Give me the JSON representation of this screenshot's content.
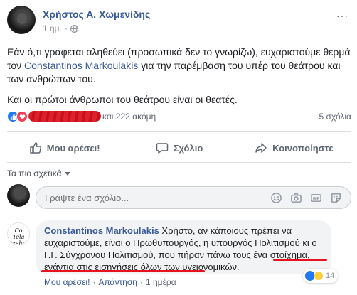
{
  "post": {
    "author": "Χρήστος Α. Χωμενίδης",
    "time": "1 ημ.",
    "separator": "·",
    "more_label": "···",
    "text_part1": "Εάν ό,τι γράφεται αληθεύει (προσωπικά δεν το γνωρίζω), ευχαριστούμε θερμά τον ",
    "mention": "Constantinos Markoulakis",
    "text_part2": " για την παρέμβαση του υπέρ του θεάτρου και των ανθρώπων του.",
    "paragraph2": "Και οι πρώτοι άνθρωποι του θεάτρου είναι οι θεατές."
  },
  "reactions": {
    "others_text": "και 222 ακόμη",
    "comments_count": "5 σχόλια"
  },
  "actions": {
    "like": "Μου αρέσει!",
    "comment": "Σχόλιο",
    "share": "Κοινοποίηστε"
  },
  "comments": {
    "sort_label": "Τα πιο σχετικά",
    "composer_placeholder": "Γράψτε ένα σχόλιο...",
    "items": [
      {
        "author": "Constantinos Markoulakis",
        "text": " Χρήστο, αν κάποιους πρέπει να ευχαριστούμε, είναι ο Πρωθυπουργός, η υπουργός Πολιτισμού κι ο Γ.Γ. Σύγχρονου Πολιτισμού, που πήραν πάνω τους ένα στοίχημα, ενάντια στις εισηγήσεις όλων των υγειονομικών.",
        "avatar_text": "Co Tela Itzehuv",
        "reaction_count": "14",
        "like_label": "Μου αρέσει!",
        "reply_label": "Απάντηση",
        "time": "1 ημέρα",
        "separator": "·"
      }
    ]
  },
  "colors": {
    "link": "#385898",
    "like_blue": "#2078f4",
    "love_red": "#f33e58",
    "annotation_red": "#e8111e",
    "secondary_text": "#606770"
  }
}
